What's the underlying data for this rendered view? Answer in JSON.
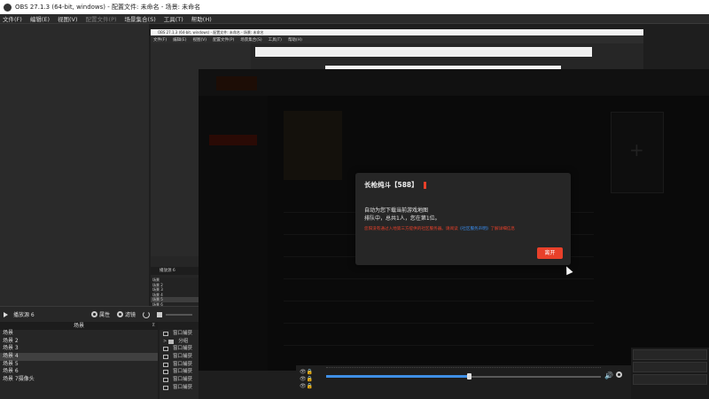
{
  "window": {
    "title": "OBS 27.1.3 (64-bit, windows) - 配置文件: 未命名 - 场景: 未命名"
  },
  "menu": {
    "items": [
      {
        "label": "文件(F)",
        "enabled": true
      },
      {
        "label": "编辑(E)",
        "enabled": true
      },
      {
        "label": "视图(V)",
        "enabled": true
      },
      {
        "label": "配置文件(P)",
        "enabled": false
      },
      {
        "label": "场景集合(S)",
        "enabled": true
      },
      {
        "label": "工具(T)",
        "enabled": true
      },
      {
        "label": "帮助(H)",
        "enabled": true
      }
    ]
  },
  "nested_obs": {
    "title": "OBS 27.1.3 (64-bit, windows) - 配置文件: 未命名 - 场景: 未命名",
    "menu": [
      "文件(F)",
      "编辑(E)",
      "视图(V)",
      "配置文件(P)",
      "场景集合(S)",
      "工具(T)",
      "帮助(H)"
    ],
    "scenes_header": "播放源 6",
    "scenes": [
      "场景",
      "场景 2",
      "场景 3",
      "场景 4",
      "场景 5",
      "场景 6",
      "场景 7摄像头"
    ],
    "selected_scene_index": 4
  },
  "dialog": {
    "title": "长枪纯斗【588】",
    "line1": "自动为您下载当前游戏地图",
    "line2": "排队中，总共1人，您在第1位。",
    "warning_prefix": "您阳没有通过入地第三方提供的社区服务器。请阅读",
    "warning_link": "《社区服务声明》",
    "warning_suffix": "了解详细信息",
    "leave_button": "离开"
  },
  "preview_bar": {
    "scene_name": "播放源 6",
    "properties_label": "属性",
    "filters_label": "滤镜"
  },
  "scenes_panel": {
    "header": "场景",
    "items": [
      "场景",
      "场景 2",
      "场景 3",
      "场景 4",
      "场景 5",
      "场景 6",
      "场景 7摄像头"
    ],
    "selected_index": 3
  },
  "sources_panel": {
    "items": [
      {
        "label": "窗口捕获",
        "icon": "window-icon"
      },
      {
        "label": "分组",
        "icon": "folder-icon"
      },
      {
        "label": "窗口捕获",
        "icon": "window-icon"
      },
      {
        "label": "窗口捕获",
        "icon": "window-icon"
      },
      {
        "label": "窗口捕获",
        "icon": "window-icon"
      },
      {
        "label": "窗口捕获",
        "icon": "window-icon"
      },
      {
        "label": "窗口捕获",
        "icon": "window-icon"
      },
      {
        "label": "窗口捕获",
        "icon": "window-icon"
      }
    ]
  },
  "mixer": {
    "volume_fraction": 0.52
  },
  "colors": {
    "accent_red": "#e8402a",
    "link_blue": "#3a8ef0",
    "volume_blue": "#3f8fe6"
  }
}
